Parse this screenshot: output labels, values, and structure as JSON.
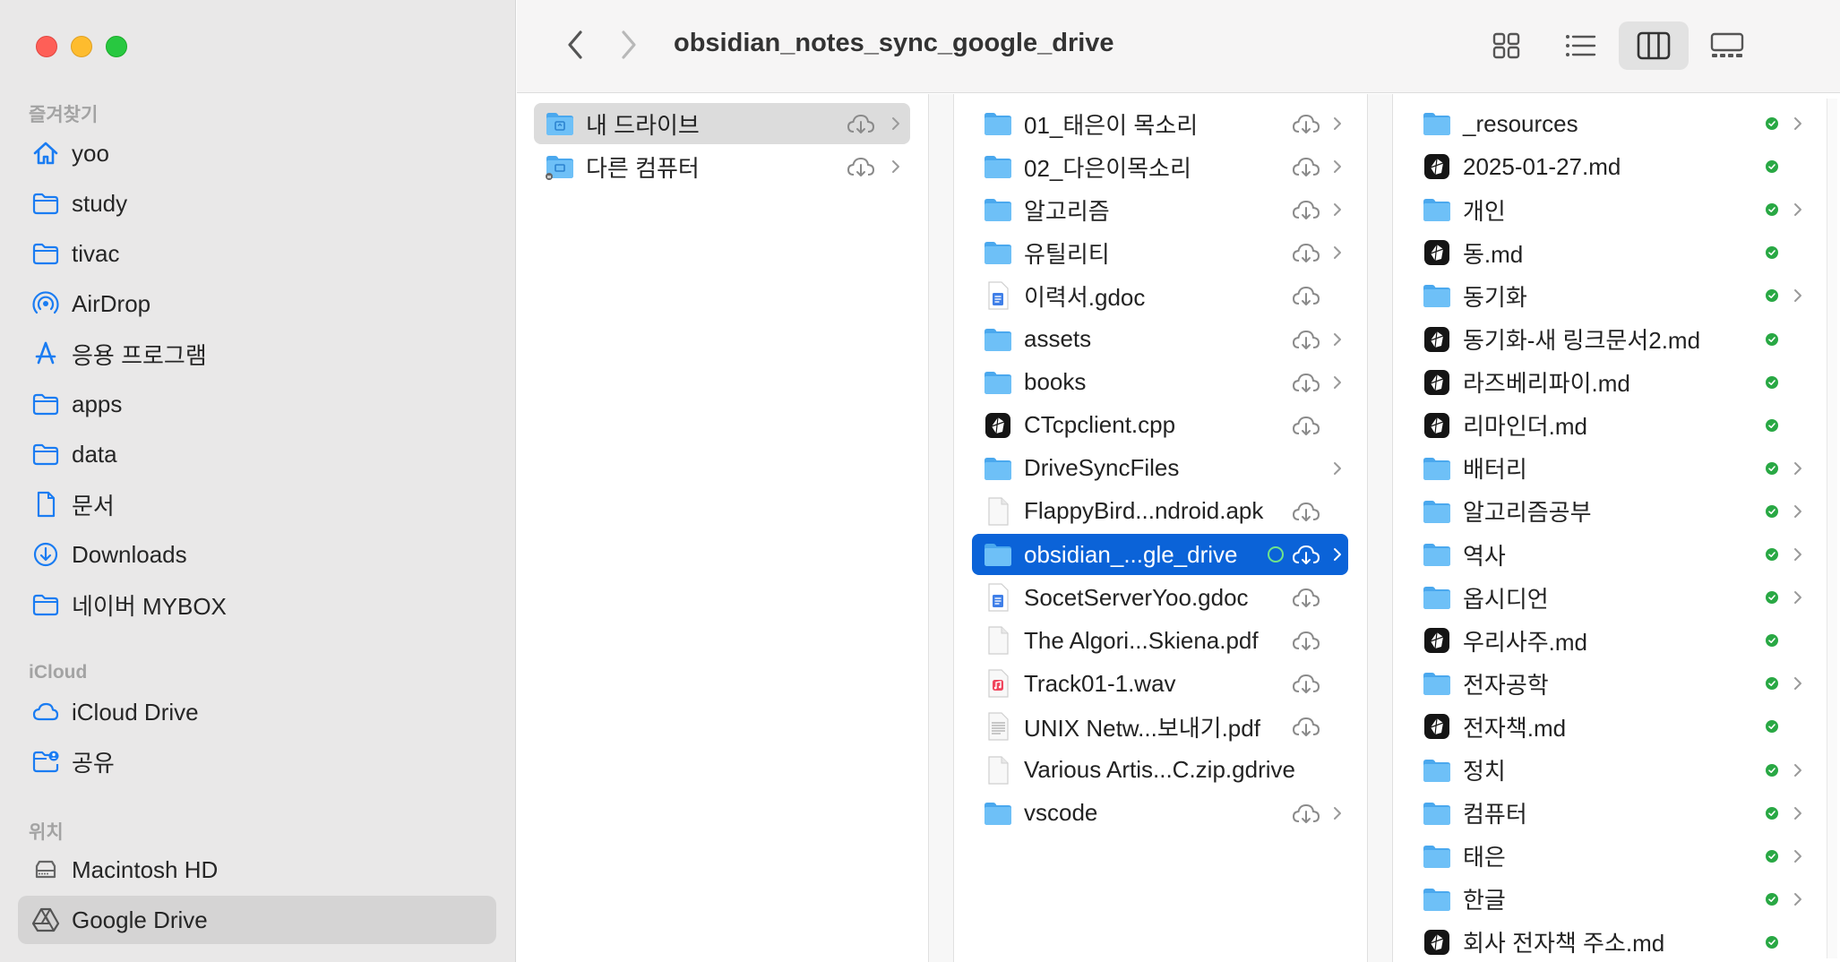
{
  "window": {
    "title": "obsidian_notes_sync_google_drive"
  },
  "sidebar": {
    "sections": {
      "favorites": "즐겨찾기",
      "icloud": "iCloud",
      "locations": "위치"
    },
    "favorites": [
      {
        "label": "yoo",
        "icon": "home-icon"
      },
      {
        "label": "study",
        "icon": "folder-icon"
      },
      {
        "label": "tivac",
        "icon": "folder-icon"
      },
      {
        "label": "AirDrop",
        "icon": "airdrop-icon"
      },
      {
        "label": "응용 프로그램",
        "icon": "applications-icon"
      },
      {
        "label": "apps",
        "icon": "folder-icon"
      },
      {
        "label": "data",
        "icon": "folder-icon"
      },
      {
        "label": "문서",
        "icon": "document-icon"
      },
      {
        "label": "Downloads",
        "icon": "download-icon"
      },
      {
        "label": "네이버 MYBOX",
        "icon": "folder-icon"
      }
    ],
    "icloud": [
      {
        "label": "iCloud Drive",
        "icon": "icloud-icon"
      },
      {
        "label": "공유",
        "icon": "shared-folder-icon"
      }
    ],
    "locations": [
      {
        "label": "Macintosh HD",
        "icon": "disk-icon"
      },
      {
        "label": "Google Drive",
        "icon": "google-drive-icon",
        "selected": true
      }
    ]
  },
  "column1": [
    {
      "name": "내 드라이브",
      "selected": true
    },
    {
      "name": "다른 컴퓨터"
    }
  ],
  "column2": [
    {
      "name": "01_태은이 목소리",
      "type": "folder"
    },
    {
      "name": "02_다은이목소리",
      "type": "folder"
    },
    {
      "name": "알고리즘",
      "type": "folder"
    },
    {
      "name": "유틸리티",
      "type": "folder"
    },
    {
      "name": "이력서.gdoc",
      "type": "gdoc"
    },
    {
      "name": "assets",
      "type": "folder"
    },
    {
      "name": "books",
      "type": "folder"
    },
    {
      "name": "CTcpclient.cpp",
      "type": "app"
    },
    {
      "name": "DriveSyncFiles",
      "type": "folder"
    },
    {
      "name": "FlappyBird...ndroid.apk",
      "type": "file"
    },
    {
      "name": "obsidian_...gle_drive",
      "type": "folder",
      "selected": true
    },
    {
      "name": "SocetServerYoo.gdoc",
      "type": "gdoc"
    },
    {
      "name": "The Algori...Skiena.pdf",
      "type": "file"
    },
    {
      "name": "Track01-1.wav",
      "type": "audio"
    },
    {
      "name": "UNIX Netw...보내기.pdf",
      "type": "pdf"
    },
    {
      "name": "Various Artis...C.zip.gdrive",
      "type": "file"
    },
    {
      "name": "vscode",
      "type": "folder"
    }
  ],
  "column3": [
    {
      "name": "_resources",
      "type": "folder"
    },
    {
      "name": "2025-01-27.md",
      "type": "md"
    },
    {
      "name": "개인",
      "type": "folder"
    },
    {
      "name": "동.md",
      "type": "md"
    },
    {
      "name": "동기화",
      "type": "folder"
    },
    {
      "name": "동기화-새 링크문서2.md",
      "type": "md"
    },
    {
      "name": "라즈베리파이.md",
      "type": "md"
    },
    {
      "name": "리마인더.md",
      "type": "md"
    },
    {
      "name": "배터리",
      "type": "folder"
    },
    {
      "name": "알고리즘공부",
      "type": "folder"
    },
    {
      "name": "역사",
      "type": "folder"
    },
    {
      "name": "옵시디언",
      "type": "folder"
    },
    {
      "name": "우리사주.md",
      "type": "md"
    },
    {
      "name": "전자공학",
      "type": "folder"
    },
    {
      "name": "전자책.md",
      "type": "md"
    },
    {
      "name": "정치",
      "type": "folder"
    },
    {
      "name": "컴퓨터",
      "type": "folder"
    },
    {
      "name": "태은",
      "type": "folder"
    },
    {
      "name": "한글",
      "type": "folder"
    },
    {
      "name": "회사 전자책 주소.md",
      "type": "md"
    }
  ],
  "colors": {
    "accent": "#0b63d8",
    "folder": "#5cb6f2",
    "sync_green": "#29a844"
  }
}
